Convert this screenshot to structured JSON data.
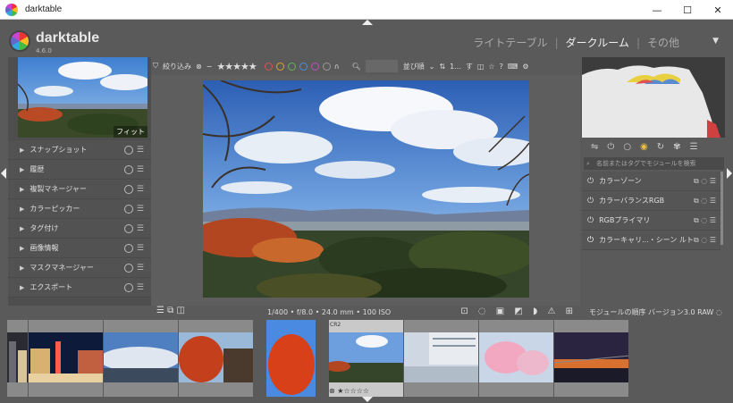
{
  "window": {
    "title": "darktable",
    "minimize": "—",
    "maximize": "☐",
    "close": "✕"
  },
  "app": {
    "name": "darktable",
    "version": "4.6.0"
  },
  "views": {
    "lighttable": "ライトテーブル",
    "darkroom": "ダークルーム",
    "other": "その他",
    "separator": "|",
    "menu_icon": "▼"
  },
  "left_panel": {
    "fit_label": "フィット",
    "modules": [
      {
        "label": "スナップショット"
      },
      {
        "label": "履歴"
      },
      {
        "label": "複製マネージャー"
      },
      {
        "label": "カラーピッカー"
      },
      {
        "label": "タグ付け"
      },
      {
        "label": "画像情報"
      },
      {
        "label": "マスクマネージャー"
      },
      {
        "label": "エクスポート"
      }
    ],
    "expand_glyph": "▶",
    "menu_glyph": "☰"
  },
  "top_toolbar": {
    "filter_label": "絞り込み",
    "reject_icon": "⊗",
    "dash": "−",
    "stars": "★★★★★",
    "sort_label": "並び順",
    "sort_field": "1...",
    "sort_toggle": "す",
    "star_icon": "☆",
    "help_icon": "?",
    "keyboard_icon": "⌨",
    "gear_icon": "⚙",
    "color_labels": [
      "#d9534f",
      "#e0a030",
      "#5cb85c",
      "#4a90d9",
      "#c050c0",
      "#999999"
    ]
  },
  "bottom_bar": {
    "exif": "1/400 • f/8.0 • 24.0 mm • 100 ISO",
    "left_icons": "☰  ⧉  ◫",
    "right_icons": "⊡ ◌ ▣ ◩ ◗ ⚠ ⊞"
  },
  "right_panel": {
    "search_placeholder": "名前またはタグでモジュールを検索",
    "modules": [
      {
        "label": "カラーゾーン"
      },
      {
        "label": "カラーバランスRGB"
      },
      {
        "label": "RGBプライマリ"
      },
      {
        "label": "カラーキャリ...・シーン ルト"
      }
    ],
    "footer": "モジュールの順序 バージョン3.0 RAW",
    "power_glyph": "⏻"
  },
  "filmstrip": {
    "active_badge": "CR2",
    "active_rating": "⊗ ★☆☆☆☆",
    "thumbnails": [
      {
        "name": "thumb-city-partial"
      },
      {
        "name": "thumb-city-night"
      },
      {
        "name": "thumb-mountain-clouds"
      },
      {
        "name": "thumb-autumn-temple"
      },
      {
        "name": "thumb-red-maple"
      },
      {
        "name": "thumb-landscape-active"
      },
      {
        "name": "thumb-building-reflection"
      },
      {
        "name": "thumb-cherry-blossom"
      },
      {
        "name": "thumb-bridge-sunset"
      }
    ]
  }
}
